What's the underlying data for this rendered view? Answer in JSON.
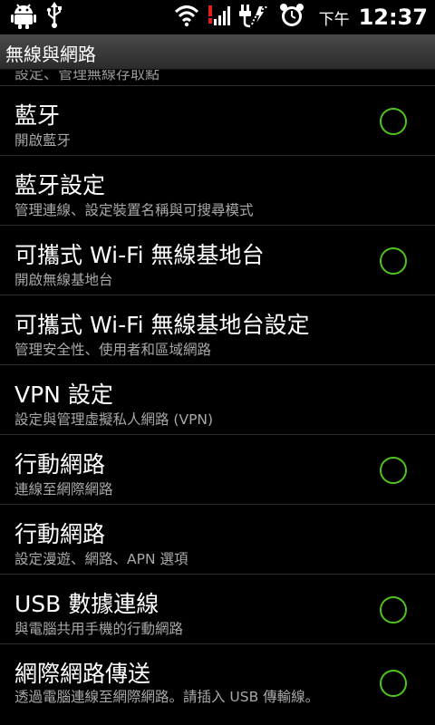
{
  "status_bar": {
    "ampm": "下午",
    "time": "12:37",
    "icons_left": [
      "android-debug-icon",
      "usb-icon"
    ],
    "icons_right": [
      "wifi-icon",
      "signal-icon",
      "charging-icon",
      "alarm-clock-icon"
    ]
  },
  "title_bar": {
    "title": "無線與網路"
  },
  "partial_item": {
    "subtitle": "設定、管理無線存取點"
  },
  "items": [
    {
      "title": "藍牙",
      "subtitle": "開啟藍牙",
      "checkbox": true
    },
    {
      "title": "藍牙設定",
      "subtitle": "管理連線、設定裝置名稱與可搜尋模式",
      "checkbox": false
    },
    {
      "title": "可攜式 Wi-Fi 無線基地台",
      "subtitle": "開啟無線基地台",
      "checkbox": true
    },
    {
      "title": "可攜式 Wi-Fi 無線基地台設定",
      "subtitle": "管理安全性、使用者和區域網路",
      "checkbox": false
    },
    {
      "title": "VPN 設定",
      "subtitle": "設定與管理虛擬私人網路 (VPN)",
      "checkbox": false
    },
    {
      "title": "行動網路",
      "subtitle": "連線至網際網路",
      "checkbox": true
    },
    {
      "title": "行動網路",
      "subtitle": "設定漫遊、網路、APN 選項",
      "checkbox": false
    },
    {
      "title": "USB 數據連線",
      "subtitle": "與電腦共用手機的行動網路",
      "checkbox": true
    },
    {
      "title": "網際網路傳送",
      "subtitle": "透過電腦連線至網際網路。請插入 USB 傳輸線。",
      "checkbox": true
    }
  ],
  "colors": {
    "accent": "#4ec41c",
    "background": "#000000",
    "subtitle": "#a8a8a8"
  }
}
